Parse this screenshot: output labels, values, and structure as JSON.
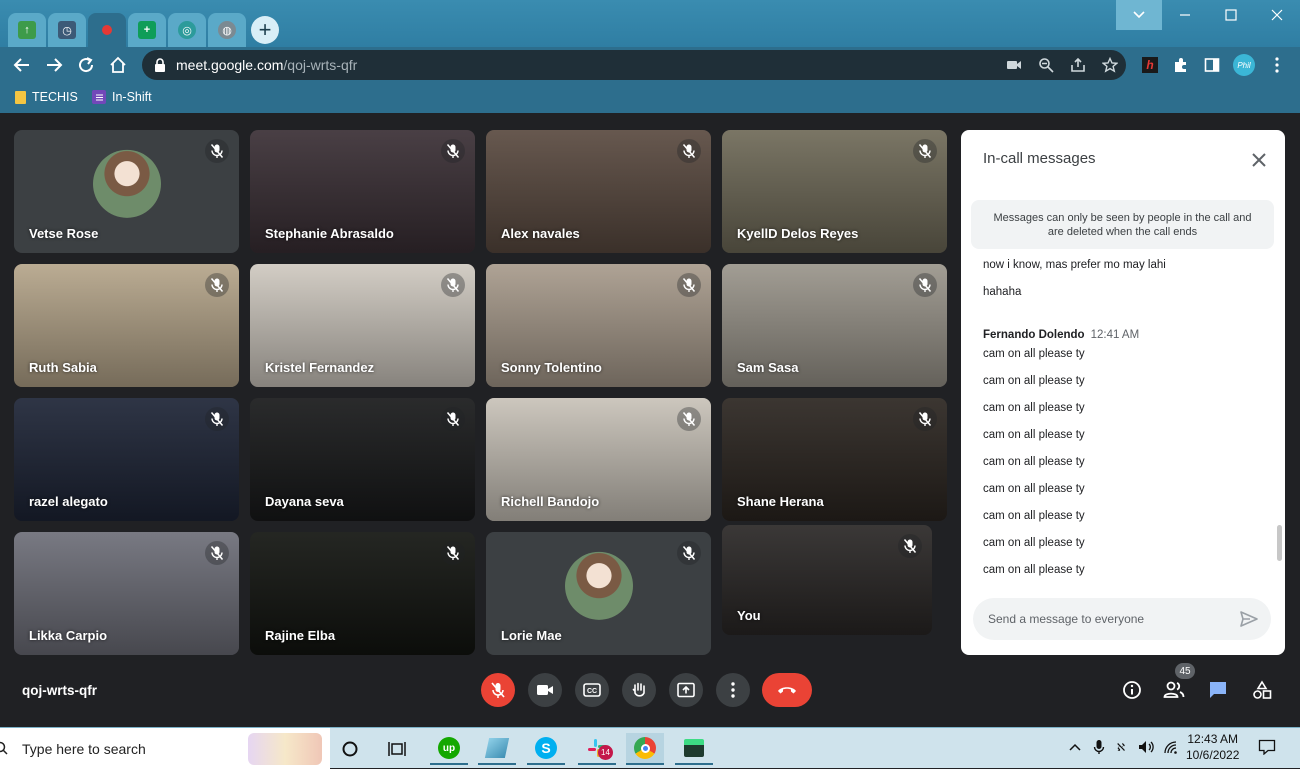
{
  "browser": {
    "url_host": "meet.google.com",
    "url_path": "/qoj-wrts-qfr",
    "bookmarks": [
      {
        "label": "TECHIS",
        "icon": "folder-icon",
        "color": "#f4c542"
      },
      {
        "label": "In-Shift",
        "icon": "forms-icon",
        "color": "#7248b9"
      }
    ],
    "profile_initials": "Phil"
  },
  "meet": {
    "participants": [
      {
        "name": "Vetse Rose",
        "bg": "#3c4043",
        "avatar": true
      },
      {
        "name": "Stephanie Abrasaldo",
        "bg": "#3a2f35"
      },
      {
        "name": "Alex navales",
        "bg": "#5a4a40"
      },
      {
        "name": "KyellD Delos Reyes",
        "bg": "#6f6a58"
      },
      {
        "name": "Ruth Sabia",
        "bg": "#b5a58a"
      },
      {
        "name": "Kristel Fernandez",
        "bg": "#cfc9c0"
      },
      {
        "name": "Sonny Tolentino",
        "bg": "#a89b8c"
      },
      {
        "name": "Sam Sasa",
        "bg": "#9a958b"
      },
      {
        "name": "razel alegato",
        "bg": "#1d2436"
      },
      {
        "name": "Dayana seva",
        "bg": "#18191a"
      },
      {
        "name": "Richell Bandojo",
        "bg": "#c8c2b8"
      },
      {
        "name": "Shane Herana",
        "bg": "#2b2520"
      },
      {
        "name": "Likka Carpio",
        "bg": "#6d6e78"
      },
      {
        "name": "Rajine Elba",
        "bg": "#121410"
      },
      {
        "name": "Lorie Mae",
        "bg": "#3c4043",
        "avatar": true
      },
      {
        "name": "You",
        "bg": "#2a2726"
      }
    ],
    "meeting_code": "qoj-wrts-qfr",
    "participant_count": "45"
  },
  "panel": {
    "title": "In-call messages",
    "notice": "Messages can only be seen by people in the call and are deleted when the call ends",
    "messages_before": [
      "now i know, mas prefer mo may lahi",
      "hahaha"
    ],
    "sender": "Fernando Dolendo",
    "sender_time": "12:41 AM",
    "messages_after": [
      "cam on all please ty",
      "cam on all please ty",
      "cam on all please ty",
      "cam on all please ty",
      "cam on all please ty",
      "cam on all please ty",
      "cam on all please ty",
      "cam on all please ty",
      "cam on all please ty"
    ],
    "input_placeholder": "Send a message to everyone"
  },
  "taskbar": {
    "search_placeholder": "Type here to search",
    "slack_badge": "14",
    "time": "12:43 AM",
    "date": "10/6/2022"
  },
  "colors": {
    "accent": "#2d6e8d",
    "meet_bg": "#202124",
    "red": "#ea4335",
    "chat_blue": "#8ab4f8"
  }
}
